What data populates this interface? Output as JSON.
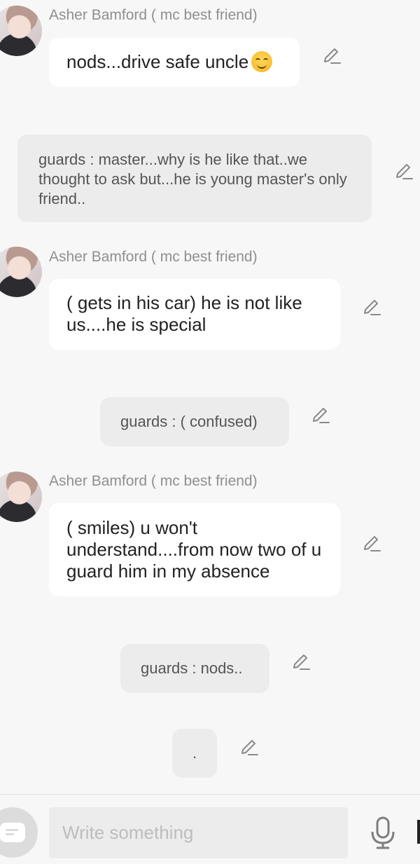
{
  "messages": [
    {
      "type": "character",
      "name": "Asher Bamford ( mc best friend)",
      "text": "nods...drive safe uncle"
    },
    {
      "type": "narration",
      "text": "guards : master...why is he like that..we thought to ask but...he is young master's only friend.."
    },
    {
      "type": "character",
      "name": "Asher Bamford ( mc best friend)",
      "text": "( gets in his car) he is not like us....he is special"
    },
    {
      "type": "narration",
      "text": "guards : ( confused)"
    },
    {
      "type": "character",
      "name": "Asher Bamford ( mc best friend)",
      "text": "( smiles) u won't understand....from now two of u guard him in my absence"
    },
    {
      "type": "narration",
      "text": "guards : nods.."
    },
    {
      "type": "narration",
      "text": "."
    }
  ],
  "composer": {
    "placeholder": "Write something"
  },
  "icons": {
    "edit": "pencil-icon",
    "mic": "microphone-icon",
    "chat": "chat-bubble-icon",
    "emoji": "smiling-face-emoji"
  },
  "colors": {
    "background": "#f7f7f7",
    "character_bubble": "#ffffff",
    "narration_bubble": "#ececec",
    "name_text": "#8f8f8f"
  }
}
